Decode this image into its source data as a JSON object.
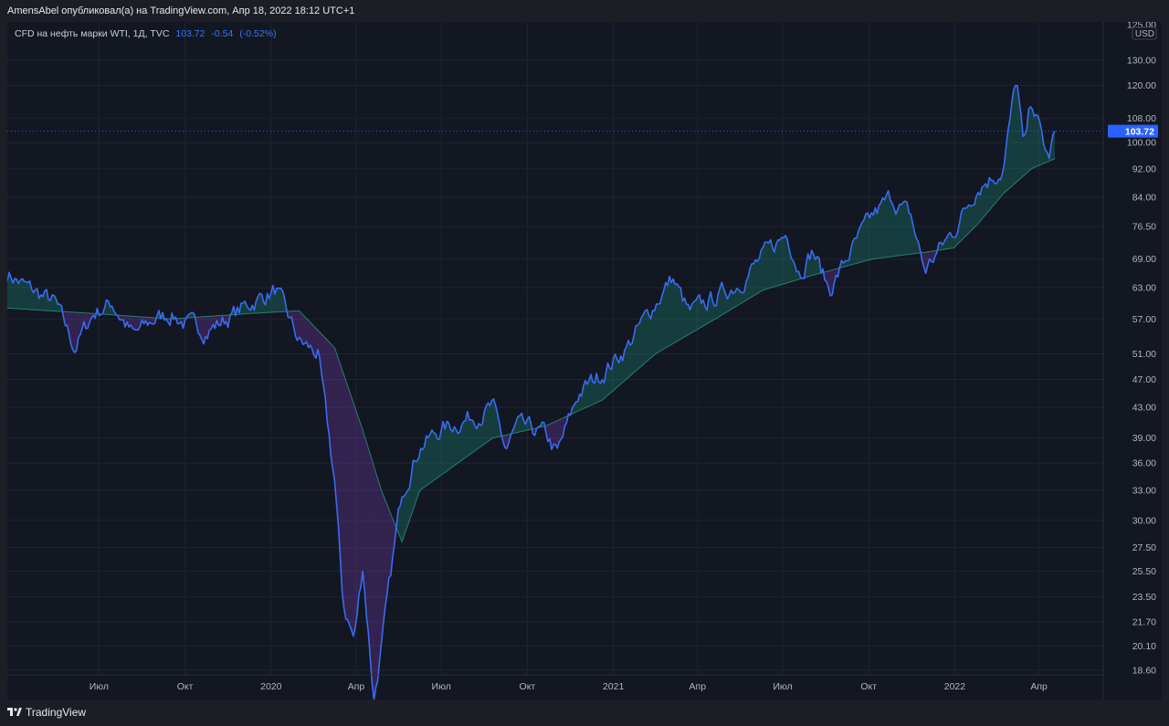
{
  "header": {
    "publisher": "AmensAbel опубликовал(а) на TradingView.com, Апр 18, 2022 18:12 UTC+1"
  },
  "legend": {
    "symbol": "CFD на нефть марки WTI, 1Д, TVC",
    "last": "103.72",
    "change": "-0.54",
    "change_pct": "(-0.52%)"
  },
  "footer": {
    "brand": "TradingView",
    "logo_icon": "tradingview-logo-icon"
  },
  "colors": {
    "price_line": "#3a6bf0",
    "up_fill": "#1f8f7a",
    "down_fill": "#7b3fb0",
    "grid": "#1f2433",
    "price_tag": "#2962ff",
    "background": "#131722"
  },
  "chart_data": {
    "type": "line",
    "title": "CFD на нефть марки WTI, 1Д, TVC",
    "yscale": "log",
    "currency": "USD",
    "ylim": [
      18,
      125
    ],
    "last_price": 103.72,
    "y_ticks": [
      "125.00",
      "130.00",
      "120.00",
      "108.00",
      "100.00",
      "92.00",
      "84.00",
      "76.50",
      "69.00",
      "63.00",
      "57.00",
      "51.00",
      "47.00",
      "43.00",
      "39.00",
      "36.00",
      "33.00",
      "30.00",
      "27.50",
      "25.50",
      "23.50",
      "21.70",
      "20.10",
      "18.60"
    ],
    "x_ticks": [
      "Июл",
      "Окт",
      "2020",
      "Апр",
      "Июл",
      "Окт",
      "2021",
      "Апр",
      "Июл",
      "Окт",
      "2022",
      "Апр"
    ],
    "grid": true,
    "series": [
      {
        "x": [
          "2019-03-25",
          "2019-04-15",
          "2019-05-15",
          "2019-06-05",
          "2019-06-25",
          "2019-07-15",
          "2019-08-07",
          "2019-08-30",
          "2019-09-16",
          "2019-10-03",
          "2019-10-25",
          "2019-11-15",
          "2019-12-10",
          "2020-01-06",
          "2020-01-31",
          "2020-02-20",
          "2020-03-09",
          "2020-03-18",
          "2020-03-30",
          "2020-04-08",
          "2020-04-20",
          "2020-04-28",
          "2020-05-20",
          "2020-06-08",
          "2020-06-30",
          "2020-07-20",
          "2020-08-25",
          "2020-09-08",
          "2020-09-20",
          "2020-10-20",
          "2020-11-02",
          "2020-11-25",
          "2020-12-20",
          "2021-01-15",
          "2021-02-15",
          "2021-03-05",
          "2021-03-23",
          "2021-04-20",
          "2021-05-15",
          "2021-06-10",
          "2021-07-06",
          "2021-07-19",
          "2021-08-02",
          "2021-08-20",
          "2021-09-10",
          "2021-10-05",
          "2021-10-25",
          "2021-11-15",
          "2021-11-30",
          "2021-12-15",
          "2021-12-31",
          "2022-01-25",
          "2022-02-22",
          "2022-03-08",
          "2022-03-16",
          "2022-03-24",
          "2022-04-11",
          "2022-04-18"
        ],
        "values": [
          66,
          63,
          60,
          52,
          58,
          60,
          54,
          57,
          58,
          56,
          55,
          57,
          60,
          62.5,
          53,
          51,
          34,
          23,
          20.5,
          26,
          17,
          20,
          33,
          38,
          40,
          41,
          43,
          37.5,
          40.5,
          39.5,
          37,
          45,
          48,
          52,
          60,
          65,
          58,
          61,
          64,
          69.5,
          75,
          66.5,
          71,
          62.5,
          70,
          79,
          84,
          79,
          66.5,
          71,
          75.5,
          87,
          92,
          123,
          97,
          115,
          94.5,
          103.7
        ]
      },
      {
        "x": [
          "2019-03-25",
          "2019-06-25",
          "2019-09-16",
          "2019-12-10",
          "2020-01-31",
          "2020-03-09",
          "2020-04-08",
          "2020-04-28",
          "2020-05-20",
          "2020-06-08",
          "2020-08-25",
          "2020-10-20",
          "2020-12-20",
          "2021-02-15",
          "2021-04-20",
          "2021-06-10",
          "2021-08-02",
          "2021-10-05",
          "2021-11-30",
          "2021-12-31",
          "2022-01-25",
          "2022-02-22",
          "2022-03-24",
          "2022-04-18"
        ],
        "values": [
          59,
          58,
          57,
          58,
          58.5,
          52,
          40,
          33,
          28,
          33,
          39,
          40.5,
          44,
          51,
          57,
          62.5,
          65.5,
          69,
          70.5,
          71.5,
          77,
          85,
          92,
          95
        ]
      }
    ]
  }
}
